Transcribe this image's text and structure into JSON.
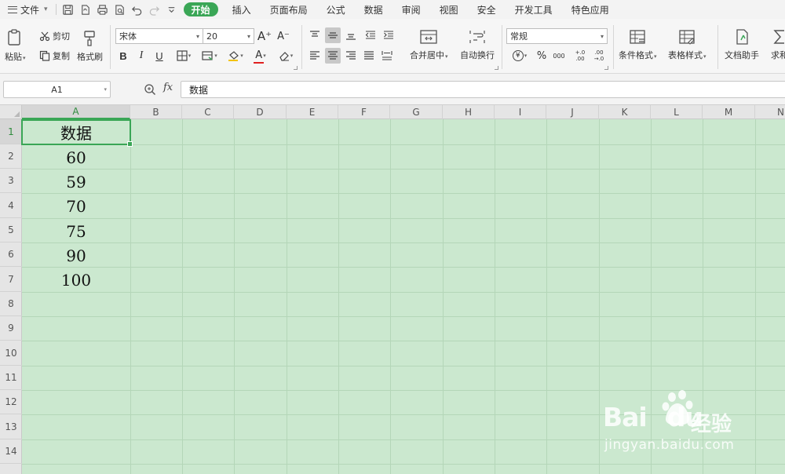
{
  "menubar": {
    "file_label": "文件",
    "tabs": [
      "开始",
      "插入",
      "页面布局",
      "公式",
      "数据",
      "审阅",
      "视图",
      "安全",
      "开发工具",
      "特色应用"
    ],
    "active_tab": "开始"
  },
  "ribbon": {
    "paste": "粘贴",
    "cut": "剪切",
    "copy": "复制",
    "format_painter": "格式刷",
    "font_name": "宋体",
    "font_size": "20",
    "merge_center": "合并居中",
    "wrap_text": "自动换行",
    "number_format": "常规",
    "conditional_format": "条件格式",
    "table_style": "表格样式",
    "doc_helper": "文档助手",
    "sum_partial": "求和",
    "bold": "B",
    "italic": "I",
    "underline": "U",
    "font_color": "A",
    "grow_font": "A⁺",
    "shrink_font": "A⁻",
    "percent": "%",
    "currency": "¥",
    "thousands": "000",
    "inc_decimal": "+.0 .00",
    "dec_decimal": ".00 →.0"
  },
  "formula_bar": {
    "name_box": "A1",
    "fx": "fx",
    "content": "数据"
  },
  "sheet": {
    "columns": [
      "A",
      "B",
      "C",
      "D",
      "E",
      "F",
      "G",
      "H",
      "I",
      "J",
      "K",
      "L",
      "M",
      "N"
    ],
    "rows": [
      "1",
      "2",
      "3",
      "4",
      "5",
      "6",
      "7",
      "8",
      "9",
      "10",
      "11",
      "12",
      "13",
      "14"
    ],
    "column_a": [
      "数据",
      "60",
      "59",
      "70",
      "75",
      "90",
      "100"
    ],
    "selected_cell": "A1",
    "background_color": "#cbe8cf"
  },
  "watermark": {
    "brand": "Bai",
    "brand_end": "du",
    "cn": "经验",
    "url": "jingyan.baidu.com"
  }
}
